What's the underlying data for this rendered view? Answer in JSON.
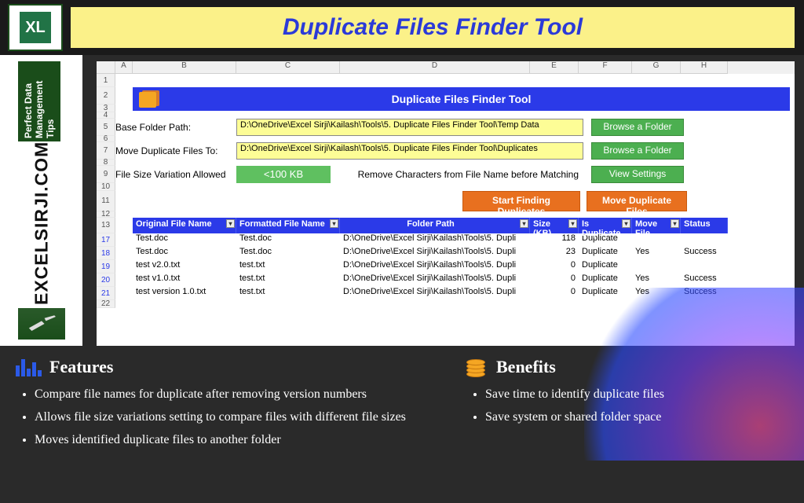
{
  "banner": {
    "title": "Duplicate Files Finder Tool",
    "excel_letter": "XL"
  },
  "sidebar": {
    "brand": "EXCELSIRJI.COM",
    "tagline": "Perfect Data Management Tips"
  },
  "sheet": {
    "columns": [
      "A",
      "B",
      "C",
      "D",
      "E",
      "F",
      "G",
      "H"
    ],
    "tool_title": "Duplicate Files Finder Tool",
    "labels": {
      "base_path": "Base Folder Path:",
      "move_to": "Move Duplicate Files To:",
      "size_var": "File Size Variation Allowed",
      "remove_chars": "Remove Characters from File Name before Matching"
    },
    "inputs": {
      "base_path": "D:\\OneDrive\\Excel Sirji\\Kailash\\Tools\\5. Duplicate Files Finder Tool\\Temp Data",
      "move_to": "D:\\OneDrive\\Excel Sirji\\Kailash\\Tools\\5. Duplicate Files Finder Tool\\Duplicates",
      "size_var": "<100 KB"
    },
    "buttons": {
      "browse1": "Browse a Folder",
      "browse2": "Browse a Folder",
      "view_settings": "View Settings",
      "start": "Start Finding Duplicates",
      "move": "Move Duplicate Files"
    },
    "headers": [
      "Original File Name",
      "Formatted File Name",
      "Folder Path",
      "Size (KB)",
      "Is Duplicate",
      "Move File",
      "Status"
    ],
    "rows": [
      {
        "n": "17",
        "orig": "Test.doc",
        "fmt": "Test.doc",
        "path": "D:\\OneDrive\\Excel Sirji\\Kailash\\Tools\\5. Dupli",
        "size": "118",
        "dup": "Duplicate",
        "move": "",
        "status": ""
      },
      {
        "n": "18",
        "orig": "Test.doc",
        "fmt": "Test.doc",
        "path": "D:\\OneDrive\\Excel Sirji\\Kailash\\Tools\\5. Dupli",
        "size": "23",
        "dup": "Duplicate",
        "move": "Yes",
        "status": "Success"
      },
      {
        "n": "19",
        "orig": "test v2.0.txt",
        "fmt": "test.txt",
        "path": "D:\\OneDrive\\Excel Sirji\\Kailash\\Tools\\5. Dupli",
        "size": "0",
        "dup": "Duplicate",
        "move": "",
        "status": ""
      },
      {
        "n": "20",
        "orig": "test v1.0.txt",
        "fmt": "test.txt",
        "path": "D:\\OneDrive\\Excel Sirji\\Kailash\\Tools\\5. Dupli",
        "size": "0",
        "dup": "Duplicate",
        "move": "Yes",
        "status": "Success"
      },
      {
        "n": "21",
        "orig": "test version 1.0.txt",
        "fmt": "test.txt",
        "path": "D:\\OneDrive\\Excel Sirji\\Kailash\\Tools\\5. Dupli",
        "size": "0",
        "dup": "Duplicate",
        "move": "Yes",
        "status": "Success"
      }
    ]
  },
  "features": {
    "title": "Features",
    "items": [
      "Compare file names for duplicate after removing version numbers",
      "Allows file size variations setting to compare files with different file sizes",
      "Moves identified duplicate files to another folder"
    ]
  },
  "benefits": {
    "title": "Benefits",
    "items": [
      "Save time to identify duplicate files",
      "Save system or shared folder space"
    ]
  }
}
